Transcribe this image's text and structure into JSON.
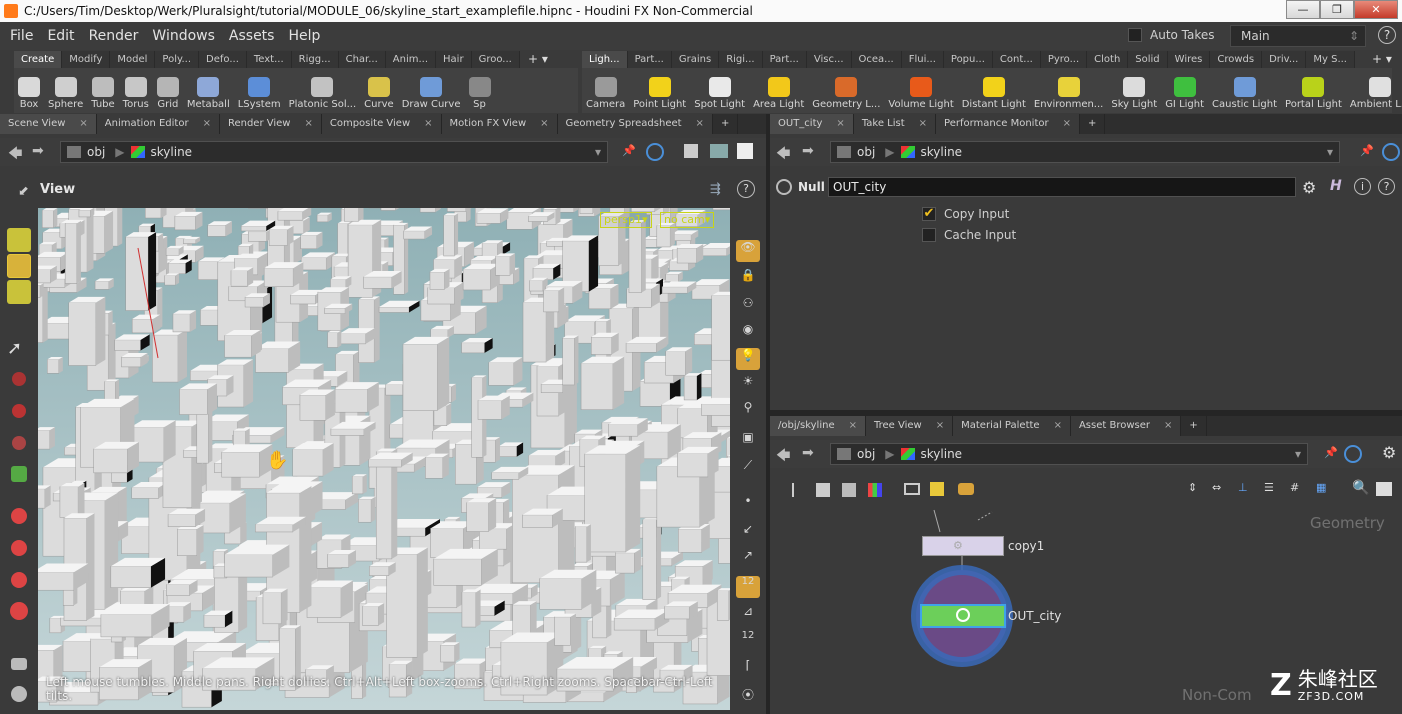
{
  "window": {
    "title": "C:/Users/Tim/Desktop/Werk/Pluralsight/tutorial/MODULE_06/skyline_start_examplefile.hipnc - Houdini FX Non-Commercial",
    "minimize": "—",
    "maximize": "❐",
    "close": "✕"
  },
  "menu": [
    "File",
    "Edit",
    "Render",
    "Windows",
    "Assets",
    "Help"
  ],
  "toolbar": {
    "auto_takes_label": "Auto Takes",
    "take_value": "Main",
    "help": "?"
  },
  "shelf_left": {
    "tabs": [
      "Create",
      "Modify",
      "Model",
      "Poly...",
      "Defo...",
      "Text...",
      "Rigg...",
      "Char...",
      "Anim...",
      "Hair",
      "Groo..."
    ],
    "tools": [
      {
        "label": "Box",
        "color": "#d9d9d9"
      },
      {
        "label": "Sphere",
        "color": "#cfcfcf"
      },
      {
        "label": "Tube",
        "color": "#bdbdbd"
      },
      {
        "label": "Torus",
        "color": "#c7c7c7"
      },
      {
        "label": "Grid",
        "color": "#b5b5b5"
      },
      {
        "label": "Metaball",
        "color": "#8ea8d8"
      },
      {
        "label": "LSystem",
        "color": "#5c8ed8"
      },
      {
        "label": "Platonic Sol...",
        "color": "#c2c2c2"
      },
      {
        "label": "Curve",
        "color": "#d9c24a"
      },
      {
        "label": "Draw Curve",
        "color": "#6f9bd8"
      },
      {
        "label": "Sp",
        "color": "#888888"
      }
    ]
  },
  "shelf_right": {
    "tabs": [
      "Ligh...",
      "Part...",
      "Grains",
      "Rigi...",
      "Part...",
      "Visc...",
      "Ocea...",
      "Flui...",
      "Popu...",
      "Cont...",
      "Pyro...",
      "Cloth",
      "Solid",
      "Wires",
      "Crowds",
      "Driv...",
      "My S..."
    ],
    "tools": [
      {
        "label": "Camera",
        "color": "#9a9a9a"
      },
      {
        "label": "Point Light",
        "color": "#f2d21a"
      },
      {
        "label": "Spot Light",
        "color": "#e9e9e9"
      },
      {
        "label": "Area Light",
        "color": "#f2c81a"
      },
      {
        "label": "Geometry L...",
        "color": "#d96a2a"
      },
      {
        "label": "Volume Light",
        "color": "#e85a1a"
      },
      {
        "label": "Distant Light",
        "color": "#f2d21a"
      },
      {
        "label": "Environmen...",
        "color": "#e8d23a"
      },
      {
        "label": "Sky Light",
        "color": "#dcdcdc"
      },
      {
        "label": "GI Light",
        "color": "#3fbf3f"
      },
      {
        "label": "Caustic Light",
        "color": "#6f9bd8"
      },
      {
        "label": "Portal Light",
        "color": "#b9d21a"
      },
      {
        "label": "Ambient L...",
        "color": "#e0e0e0"
      }
    ]
  },
  "left_pane": {
    "tabs": [
      "Scene View",
      "Animation Editor",
      "Render View",
      "Composite View",
      "Motion FX View",
      "Geometry Spreadsheet"
    ],
    "path": [
      "obj",
      "skyline"
    ],
    "view_title": "View",
    "camera_menu": "persp1▾",
    "cam_menu": "no cam▾",
    "hint": "Left mouse tumbles. Middle pans. Right dollies. Ctrl+Alt+Left box-zooms. Ctrl+Right zooms. Spacebar-Ctrl-Left tilts.",
    "right_tool_labels": [
      "12",
      "12"
    ]
  },
  "param_pane": {
    "tabs": [
      "OUT_city",
      "Take List",
      "Performance Monitor"
    ],
    "path": [
      "obj",
      "skyline"
    ],
    "node_type": "Null",
    "node_name": "OUT_city",
    "params": [
      {
        "label": "Copy Input",
        "checked": true
      },
      {
        "label": "Cache Input",
        "checked": false
      }
    ]
  },
  "network_pane": {
    "tabs": [
      "/obj/skyline",
      "Tree View",
      "Material Palette",
      "Asset Browser"
    ],
    "path": [
      "obj",
      "skyline"
    ],
    "nodes": [
      {
        "name": "copy1"
      },
      {
        "name": "OUT_city"
      }
    ],
    "context_watermark": "Geometry",
    "license_watermark": "Non-Com"
  },
  "site_watermark": {
    "cn": "朱峰社区",
    "url": "ZF3D.COM"
  }
}
